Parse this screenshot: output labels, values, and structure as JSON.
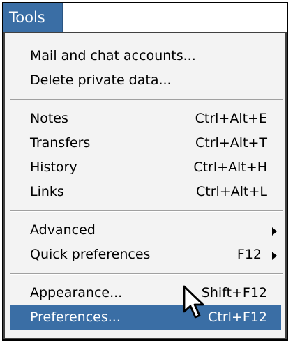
{
  "menubar": {
    "title": "Tools"
  },
  "groups": {
    "accounts": [
      {
        "label": "Mail and chat accounts...",
        "shortcut": ""
      },
      {
        "label": "Delete private data...",
        "shortcut": ""
      }
    ],
    "panels": [
      {
        "label": "Notes",
        "shortcut": "Ctrl+Alt+E"
      },
      {
        "label": "Transfers",
        "shortcut": "Ctrl+Alt+T"
      },
      {
        "label": "History",
        "shortcut": "Ctrl+Alt+H"
      },
      {
        "label": "Links",
        "shortcut": "Ctrl+Alt+L"
      }
    ],
    "submenus": [
      {
        "label": "Advanced",
        "shortcut": ""
      },
      {
        "label": "Quick preferences",
        "shortcut": "F12"
      }
    ],
    "settings": [
      {
        "label": "Appearance...",
        "shortcut": "Shift+F12"
      },
      {
        "label": "Preferences...",
        "shortcut": "Ctrl+F12"
      }
    ]
  },
  "colors": {
    "highlight": "#3a6ea5",
    "menu_background": "#f3f3f3"
  },
  "icons": {
    "submenu_arrow": "triangle-right-icon",
    "cursor": "mouse-pointer-icon"
  }
}
